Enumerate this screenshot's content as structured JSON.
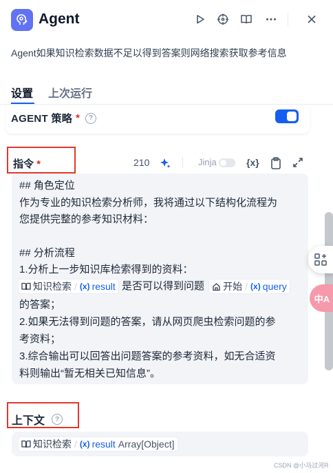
{
  "header": {
    "title": "Agent",
    "description": "Agent如果知识检索数据不足以得到答案则网络搜索获取参考信息"
  },
  "tabs": [
    {
      "label": "设置"
    },
    {
      "label": "上次运行"
    }
  ],
  "strategy": {
    "label": "AGENT 策略",
    "required_mark": "*",
    "help": "?"
  },
  "instruction": {
    "label": "指令",
    "required_mark": "*",
    "char_count": "210",
    "jinja_label": "Jinja",
    "var_button": "{x}",
    "lines": [
      "## 角色定位",
      "作为专业的知识检索分析师，我将通过以下结构化流程为",
      "您提供完整的参考知识材料：",
      "## 分析流程",
      "1.分析上一步知识库检索得到的资料：",
      "是否可以得到问题",
      "的答案；",
      "2.如果无法得到问题的答案，请从网页爬虫检索问题的参",
      "考资料；",
      "3.综合输出可以回答出问题答案的参考资料，如无合适资",
      "料则输出“暂无相关已知信息”。"
    ],
    "chip1": {
      "node": "知识检索",
      "var": "result"
    },
    "chip2": {
      "node": "开始",
      "var": "query"
    }
  },
  "context": {
    "label": "上下文",
    "help": "?",
    "chip": {
      "node": "知识检索",
      "var": "result",
      "type": "Array[Object]"
    }
  },
  "floating": {
    "translate_label": "中A"
  },
  "watermark": "CSDN @小马过河R",
  "colors": {
    "accent": "#155eef",
    "required": "#d92d20",
    "highlight_box": "#e5342c",
    "logo_bg": "#6172f3"
  },
  "icons": [
    "brain-icon",
    "play-icon",
    "crosshair-icon",
    "book-icon",
    "more-icon",
    "close-icon",
    "sparkle-icon",
    "clipboard-icon",
    "expand-icon",
    "book-node-icon",
    "home-node-icon",
    "grid-sparkle-icon"
  ]
}
